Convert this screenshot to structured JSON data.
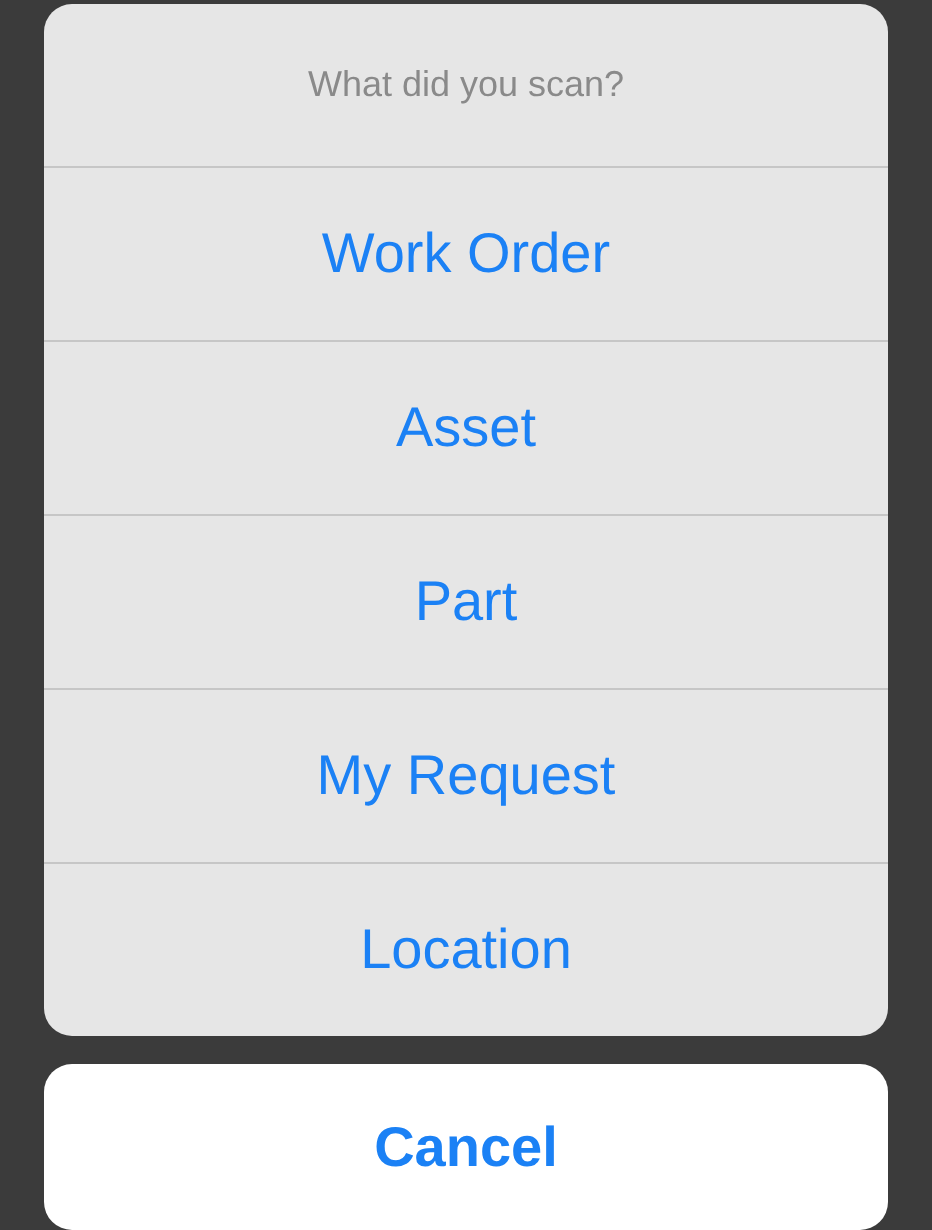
{
  "sheet": {
    "title": "What did you scan?",
    "options": [
      {
        "label": "Work Order"
      },
      {
        "label": "Asset"
      },
      {
        "label": "Part"
      },
      {
        "label": "My Request"
      },
      {
        "label": "Location"
      }
    ]
  },
  "cancel": {
    "label": "Cancel"
  }
}
